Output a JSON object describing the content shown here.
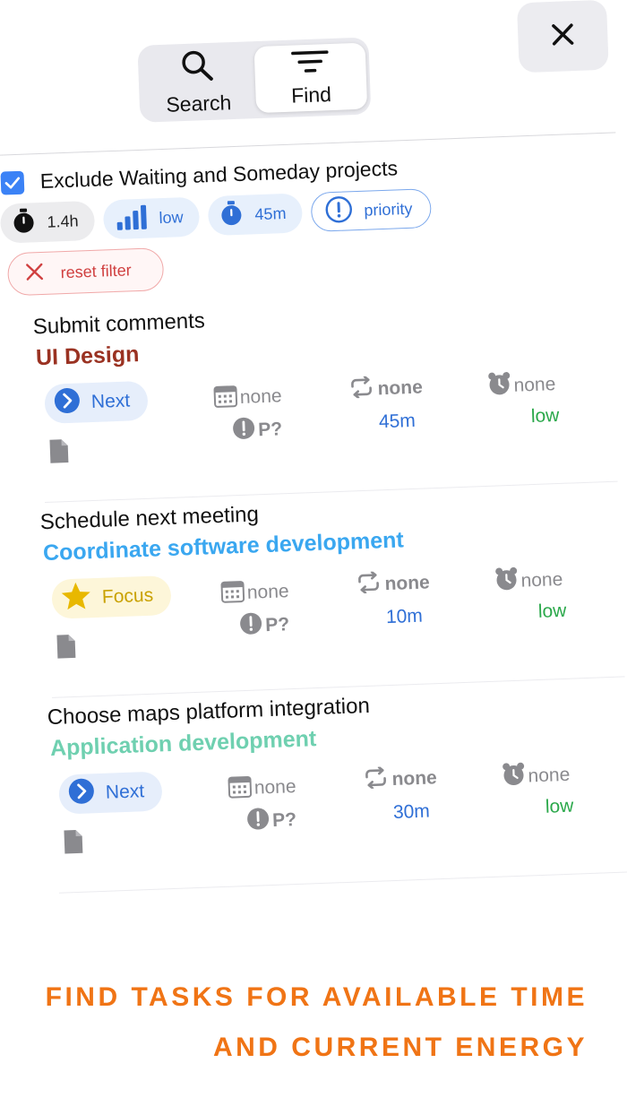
{
  "header": {
    "segments": [
      {
        "label": "Search",
        "icon": "magnifier-icon"
      },
      {
        "label": "Find",
        "icon": "filter-lines-icon",
        "selected": true
      }
    ],
    "close_icon": "close-icon"
  },
  "filters": {
    "exclude_label": "Exclude Waiting and Someday projects",
    "exclude_checked": true,
    "chips": {
      "time": "1.4h",
      "energy": "low",
      "duration": "45m",
      "priority": "priority"
    },
    "reset_label": "reset filter"
  },
  "tasks": [
    {
      "title": "Submit comments",
      "project": "UI Design",
      "project_color": "#9a3222",
      "status": "Next",
      "due": "none",
      "priority": "P?",
      "repeat": "none",
      "duration": "45m",
      "alarm": "none",
      "energy": "low"
    },
    {
      "title": "Schedule next meeting",
      "project": "Coordinate software development",
      "project_color": "#3aa7f0",
      "status": "Focus",
      "due": "none",
      "priority": "P?",
      "repeat": "none",
      "duration": "10m",
      "alarm": "none",
      "energy": "low"
    },
    {
      "title": "Choose maps platform integration",
      "project": "Application development",
      "project_color": "#6fd0b0",
      "status": "Next",
      "due": "none",
      "priority": "P?",
      "repeat": "none",
      "duration": "30m",
      "alarm": "none",
      "energy": "low"
    }
  ],
  "tagline": {
    "line1": "FIND TASKS FOR AVAILABLE TIME",
    "line2": "AND CURRENT ENERGY"
  },
  "colors": {
    "accent_blue": "#2f6fd6",
    "energy_green": "#2aa84a",
    "reset_red": "#d04040",
    "tagline_orange": "#f07415",
    "focus_gold": "#c9a100"
  }
}
